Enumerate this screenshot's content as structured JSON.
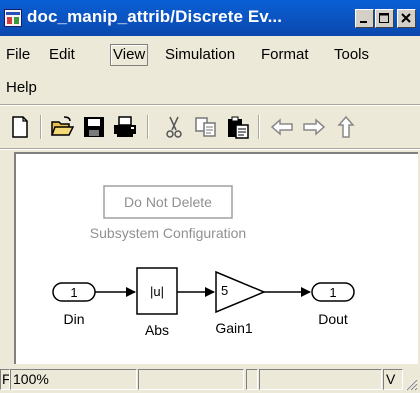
{
  "window": {
    "title": "doc_manip_attrib/Discrete Ev...",
    "icon": "simulink-model-icon",
    "controls": [
      "minimize-icon",
      "maximize-icon",
      "close-icon"
    ]
  },
  "menu": {
    "file": "File",
    "edit": "Edit",
    "view": "View",
    "simulation": "Simulation",
    "format": "Format",
    "tools": "Tools",
    "help": "Help"
  },
  "toolbar": {
    "icons": [
      "new-document-icon",
      "open-folder-icon",
      "save-icon",
      "print-icon",
      "cut-icon",
      "copy-icon",
      "paste-icon",
      "back-arrow-icon",
      "forward-arrow-icon",
      "up-arrow-icon"
    ]
  },
  "diagram": {
    "config_block_label": "Do Not Delete",
    "config_block_caption": "Subsystem Configuration",
    "inport_value": "1",
    "inport_name": "Din",
    "abs_symbol": "|u|",
    "abs_name": "Abs",
    "gain_value": "5",
    "gain_name": "Gain1",
    "outport_value": "1",
    "outport_name": "Dout"
  },
  "status": {
    "left_fragment": "F",
    "zoom": "100%",
    "right_fragment": "V"
  }
}
